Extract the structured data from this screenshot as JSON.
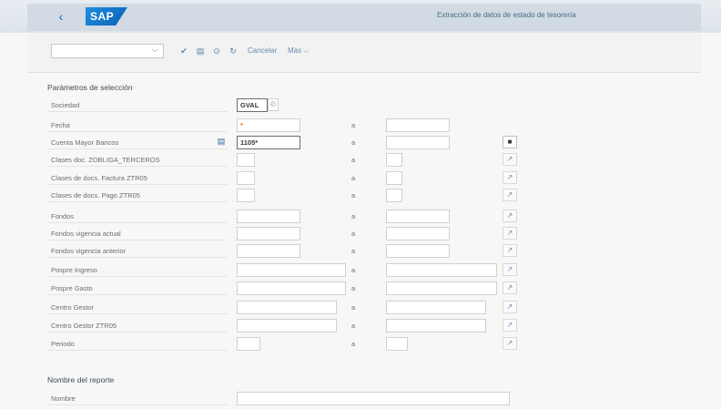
{
  "shell": {
    "back_icon": "chevron-left-icon",
    "logo_text": "SAP",
    "title": "Extracción de datos de estado de tesorería"
  },
  "toolbar": {
    "variant_value": "",
    "save_label": "Cancelar",
    "more_label": "Más",
    "icons": [
      "checkmark-icon",
      "save-variant-icon",
      "get-variant-icon",
      "reset-icon"
    ]
  },
  "section1": {
    "title": "Parámetros de selección",
    "a_label": "a",
    "rows": [
      {
        "label": "Sociedad",
        "from": "GVAL",
        "to": null
      },
      {
        "label": "Fecha",
        "from": "*",
        "to": ""
      },
      {
        "label": "Cuenta Mayor Bancos",
        "from": "1105*",
        "to": ""
      },
      {
        "label": "Clases doc. ZOBLIGA_TERCEROS",
        "from": "",
        "to": ""
      },
      {
        "label": "Clases de docs. Factura ZTR05",
        "from": "",
        "to": ""
      },
      {
        "label": "Clases de docs. Pago ZTR05",
        "from": "",
        "to": ""
      },
      {
        "label": "Fondos",
        "from": "",
        "to": ""
      },
      {
        "label": "Fondos vigencia actual",
        "from": "",
        "to": ""
      },
      {
        "label": "Fondos vigencia anterior",
        "from": "",
        "to": ""
      },
      {
        "label": "Pospre Ingreso",
        "from": "",
        "to": ""
      },
      {
        "label": "Pospre Gasto",
        "from": "",
        "to": ""
      },
      {
        "label": "Centro Gestor",
        "from": "",
        "to": ""
      },
      {
        "label": "Centro Gestor ZTR05",
        "from": "",
        "to": ""
      },
      {
        "label": "Periodo",
        "from": "",
        "to": ""
      }
    ]
  },
  "section2": {
    "title": "Nombre del reporte",
    "rows": [
      {
        "label": "Nombre",
        "value": ""
      }
    ]
  },
  "colors": {
    "accent": "#0a6ed1",
    "required": "#e9730c"
  }
}
